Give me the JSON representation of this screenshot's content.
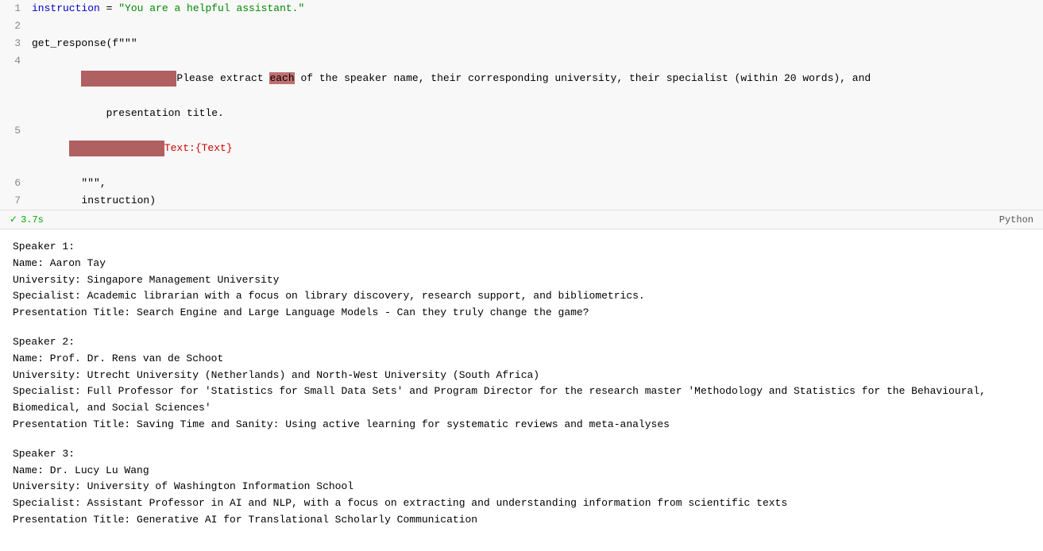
{
  "code": {
    "lines": [
      {
        "number": 1,
        "parts": [
          {
            "type": "var",
            "text": "instruction"
          },
          {
            "type": "plain",
            "text": " = "
          },
          {
            "type": "string",
            "text": "\"You are a helpful assistant.\""
          }
        ],
        "highlighted": false
      },
      {
        "number": 2,
        "parts": [],
        "highlighted": false
      },
      {
        "number": 3,
        "parts": [
          {
            "type": "func",
            "text": "get_response"
          },
          {
            "type": "plain",
            "text": "(f\"\"\""
          }
        ],
        "highlighted": false
      },
      {
        "number": 4,
        "parts": [
          {
            "type": "highlight_block",
            "text": ""
          },
          {
            "type": "plain",
            "text": "Please extract each of the speaker name, their corresponding university, their specialist (within 20 words), and"
          }
        ],
        "highlighted": true,
        "continuation": "            presentation title."
      },
      {
        "number": 5,
        "parts": [
          {
            "type": "highlight_block",
            "text": ""
          },
          {
            "type": "plain",
            "text": "Text:{Text}"
          }
        ],
        "highlighted": true
      },
      {
        "number": 6,
        "parts": [
          {
            "type": "plain",
            "text": "        \"\"\","
          }
        ],
        "highlighted": false
      },
      {
        "number": 7,
        "parts": [
          {
            "type": "plain",
            "text": "        instruction)"
          }
        ],
        "highlighted": false
      }
    ]
  },
  "status": {
    "check": "✓",
    "time": "3.7s",
    "language": "Python"
  },
  "output": {
    "sections": [
      {
        "id": "speaker1",
        "lines": [
          "Speaker 1:",
          "Name: Aaron Tay",
          "University: Singapore Management University",
          "Specialist: Academic librarian with a focus on library discovery, research support, and bibliometrics.",
          "Presentation Title: Search Engine and Large Language Models - Can they truly change the game?"
        ]
      },
      {
        "id": "speaker2",
        "lines": [
          "Speaker 2:",
          "Name: Prof. Dr. Rens van de Schoot",
          "University: Utrecht University (Netherlands) and North-West University (South Africa)",
          "Specialist: Full Professor for 'Statistics for Small Data Sets' and Program Director for the research master 'Methodology and Statistics for the Behavioural, Biomedical, and Social Sciences'",
          "Presentation Title: Saving Time and Sanity: Using active learning for systematic reviews and meta-analyses"
        ]
      },
      {
        "id": "speaker3",
        "lines": [
          "Speaker 3:",
          "Name: Dr. Lucy Lu Wang",
          "University: University of Washington Information School",
          "Specialist: Assistant Professor in AI and NLP, with a focus on extracting and understanding information from scientific texts",
          "Presentation Title: Generative AI for Translational Scholarly Communication"
        ]
      }
    ]
  }
}
